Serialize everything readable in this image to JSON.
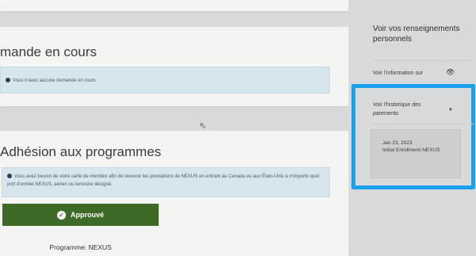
{
  "requests": {
    "title": "mande en cours",
    "empty_message": "Vous n'avez aucune demande en cours"
  },
  "programs": {
    "title": "Adhésion aux programmes",
    "info_message": "Vous avez besoin de votre carte de membre afin de recevoir les prestations de NEXUS en entrant au Canada ou aux États-Unis à n'importe quel port d'entrée NEXUS, aérien ou terrestre désigné.",
    "status_label": "Approuvé",
    "program_line": "Programme: NEXUS"
  },
  "sidebar": {
    "heading": "Voir vos renseignements personnels",
    "view_info_link": "Voir l'information sur",
    "payment_history_link": "Voir l'historique des paiements",
    "payment": {
      "date": "Jan 23, 2023",
      "description": "Initial Enrollment-NEXUS"
    }
  },
  "colors": {
    "status_green": "#3d6b27",
    "alert_blue": "#d6e6ec",
    "highlight": "#1aa0f1"
  },
  "icons": {
    "info": "info-icon",
    "check": "check-icon",
    "eye": "eye-icon",
    "caret": "caret-down-icon",
    "cursor": "mouse-cursor-icon"
  }
}
